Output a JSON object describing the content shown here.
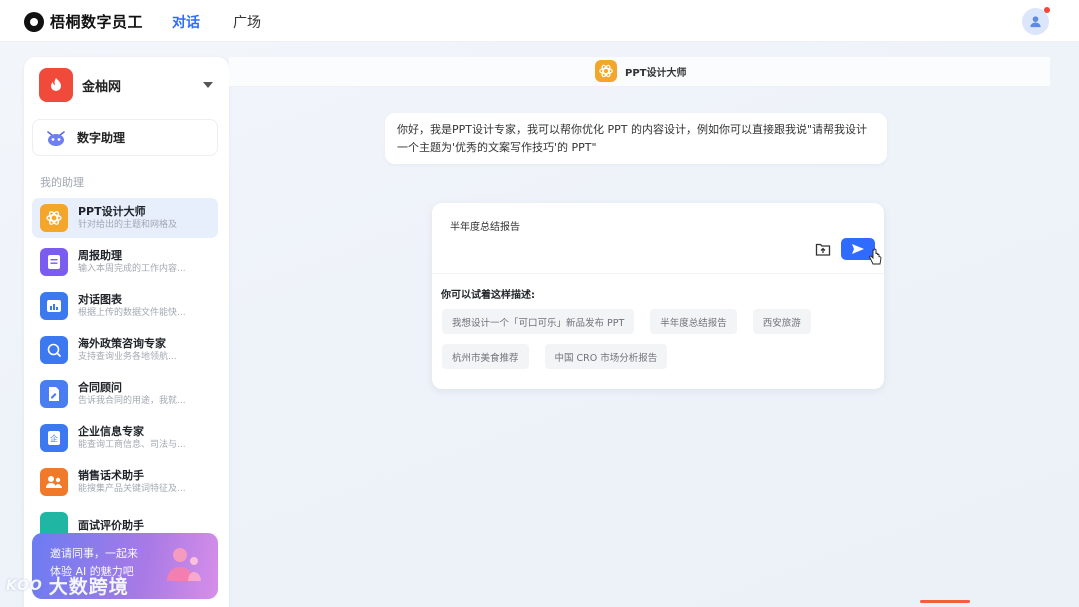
{
  "app": {
    "name": "梧桐数字员工",
    "nav": {
      "chat": "对话",
      "square": "广场"
    }
  },
  "sidebar": {
    "org_name": "金柚网",
    "digital_helper": "数字助理",
    "section_title": "我的助理",
    "assistants": [
      {
        "name": "PPT设计大师",
        "desc": "针对给出的主题和网格及",
        "color": "#f4a62a",
        "icon": "atom-icon",
        "active": true
      },
      {
        "name": "周报助理",
        "desc": "输入本周完成的工作内容...",
        "color": "#7b5cf0",
        "icon": "document-icon",
        "active": false
      },
      {
        "name": "对话图表",
        "desc": "根据上传的数据文件能快...",
        "color": "#3c78f0",
        "icon": "chart-icon",
        "active": false
      },
      {
        "name": "海外政策咨询专家",
        "desc": "支持查询业务各地领航...",
        "color": "#3c78f0",
        "icon": "globe-icon",
        "active": false
      },
      {
        "name": "合同顾问",
        "desc": "告诉我合同的用途，我就...",
        "color": "#4a7df2",
        "icon": "contract-icon",
        "active": false
      },
      {
        "name": "企业信息专家",
        "desc": "能查询工商信息、司法与...",
        "color": "#3c78f0",
        "icon": "enterprise-icon",
        "active": false
      },
      {
        "name": "销售话术助手",
        "desc": "能搜集产品关键词特征及...",
        "color": "#f07a2a",
        "icon": "people-icon",
        "active": false
      },
      {
        "name": "面试评价助手",
        "desc": "",
        "color": "#1fb6a4",
        "icon": "interview-icon",
        "active": false
      }
    ],
    "invite": {
      "line1": "邀请同事，一起来",
      "line2": "体验 AI 的魅力吧"
    }
  },
  "watermark": {
    "mark": "KOO",
    "text": "大数跨境"
  },
  "main": {
    "agent_title": "PPT设计大师",
    "greeting": "你好，我是PPT设计专家，我可以帮你优化 PPT 的内容设计，例如你可以直接跟我说\"请帮我设计一个主题为'优秀的文案写作技巧'的 PPT\"",
    "input_value": "半年度总结报告",
    "suggest_title": "你可以试着这样描述:",
    "suggestions": [
      [
        "我想设计一个「可口可乐」新品发布 PPT",
        "半年度总结报告",
        "西安旅游"
      ],
      [
        "杭州市美食推荐",
        "中国 CRO 市场分析报告"
      ]
    ]
  },
  "colors": {
    "primary": "#2f6bff",
    "org": "#f04a3a"
  }
}
